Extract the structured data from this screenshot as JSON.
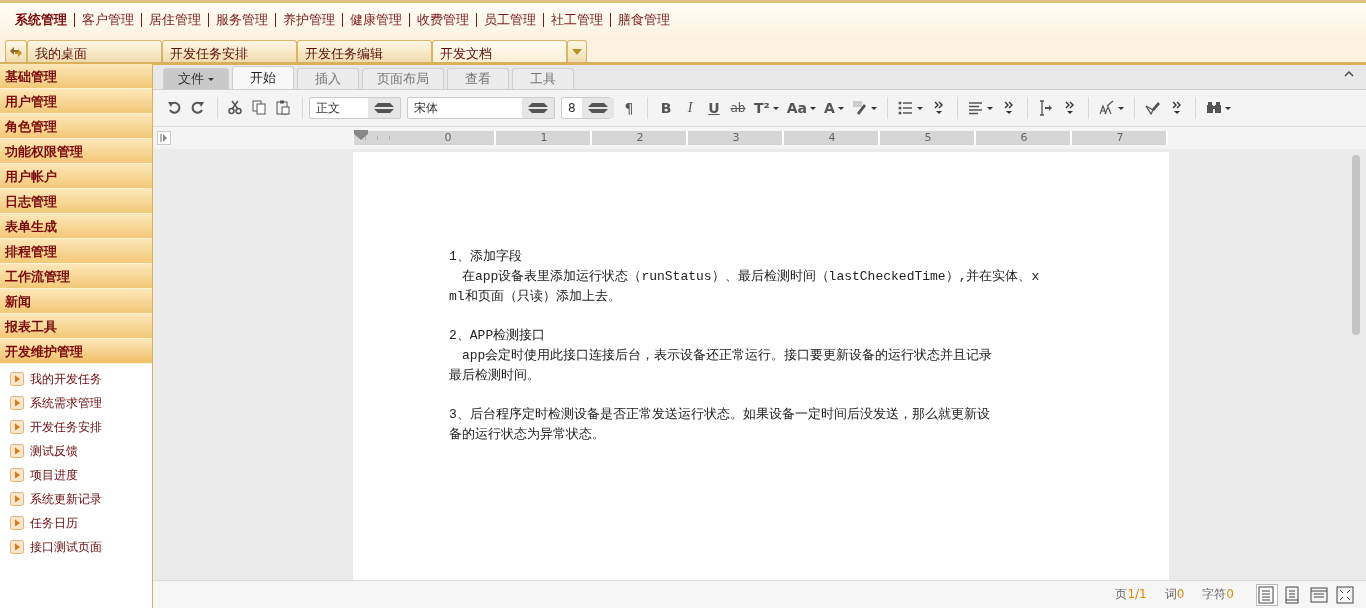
{
  "top_nav": [
    {
      "label": "系统管理",
      "selected": true
    },
    {
      "label": "客户管理",
      "selected": false
    },
    {
      "label": "居住管理",
      "selected": false
    },
    {
      "label": "服务管理",
      "selected": false
    },
    {
      "label": "养护管理",
      "selected": false
    },
    {
      "label": "健康管理",
      "selected": false
    },
    {
      "label": "收费管理",
      "selected": false
    },
    {
      "label": "员工管理",
      "selected": false
    },
    {
      "label": "社工管理",
      "selected": false
    },
    {
      "label": "膳食管理",
      "selected": false
    }
  ],
  "page_tabs": [
    {
      "label": "我的桌面",
      "selected": false
    },
    {
      "label": "开发任务安排",
      "selected": false
    },
    {
      "label": "开发任务编辑",
      "selected": false
    },
    {
      "label": "开发文档",
      "selected": true
    }
  ],
  "sidebar": {
    "groups": [
      {
        "label": "基础管理",
        "expanded": false
      },
      {
        "label": "用户管理",
        "expanded": false
      },
      {
        "label": "角色管理",
        "expanded": false
      },
      {
        "label": "功能权限管理",
        "expanded": false
      },
      {
        "label": "用户帐户",
        "expanded": false
      },
      {
        "label": "日志管理",
        "expanded": false
      },
      {
        "label": "表单生成",
        "expanded": false
      },
      {
        "label": "排程管理",
        "expanded": false
      },
      {
        "label": "工作流管理",
        "expanded": false
      },
      {
        "label": "新闻",
        "expanded": false
      },
      {
        "label": "报表工具",
        "expanded": false
      },
      {
        "label": "开发维护管理",
        "expanded": true,
        "children": [
          {
            "label": "我的开发任务"
          },
          {
            "label": "系统需求管理"
          },
          {
            "label": "开发任务安排"
          },
          {
            "label": "测试反馈"
          },
          {
            "label": "项目进度"
          },
          {
            "label": "系统更新记录"
          },
          {
            "label": "任务日历"
          },
          {
            "label": "接口测试页面"
          }
        ]
      }
    ]
  },
  "ribbon_tabs": [
    {
      "label": "文件",
      "kind": "menu",
      "selected": false
    },
    {
      "label": "开始",
      "kind": "tab",
      "selected": true
    },
    {
      "label": "插入",
      "kind": "tab",
      "selected": false
    },
    {
      "label": "页面布局",
      "kind": "tab",
      "selected": false
    },
    {
      "label": "查看",
      "kind": "tab",
      "selected": false
    },
    {
      "label": "工具",
      "kind": "tab",
      "selected": false
    }
  ],
  "toolbar": {
    "style": "正文",
    "font": "宋体",
    "size": "8",
    "text_buttons": [
      "¶",
      "B",
      "I",
      "U",
      "ab",
      "T²",
      "Aa",
      "A"
    ]
  },
  "ruler": {
    "labels": [
      "0",
      "1",
      "2",
      "3",
      "4",
      "5",
      "6",
      "7"
    ]
  },
  "document": {
    "paragraphs": [
      {
        "lines": [
          "1、添加字段",
          "　在app设备表里添加运行状态（runStatus）、最后检测时间（lastCheckedTime）,并在实体、x",
          "ml和页面（只读）添加上去。"
        ]
      },
      {
        "lines": [
          "2、APP检测接口",
          "　app会定时使用此接口连接后台，表示设备还正常运行。接口要更新设备的运行状态并且记录",
          "最后检测时间。"
        ]
      },
      {
        "lines": [
          "3、后台程序定时检测设备是否正常发送运行状态。如果设备一定时间后没发送，那么就更新设",
          "备的运行状态为异常状态。"
        ]
      }
    ]
  },
  "status_bar": {
    "counters": [
      {
        "label": "页",
        "value": "1/1"
      },
      {
        "label": "词",
        "value": "0"
      },
      {
        "label": "字符",
        "value": "0"
      }
    ],
    "views": [
      {
        "selected": true
      },
      {
        "selected": false
      },
      {
        "selected": false
      },
      {
        "selected": false
      }
    ]
  }
}
